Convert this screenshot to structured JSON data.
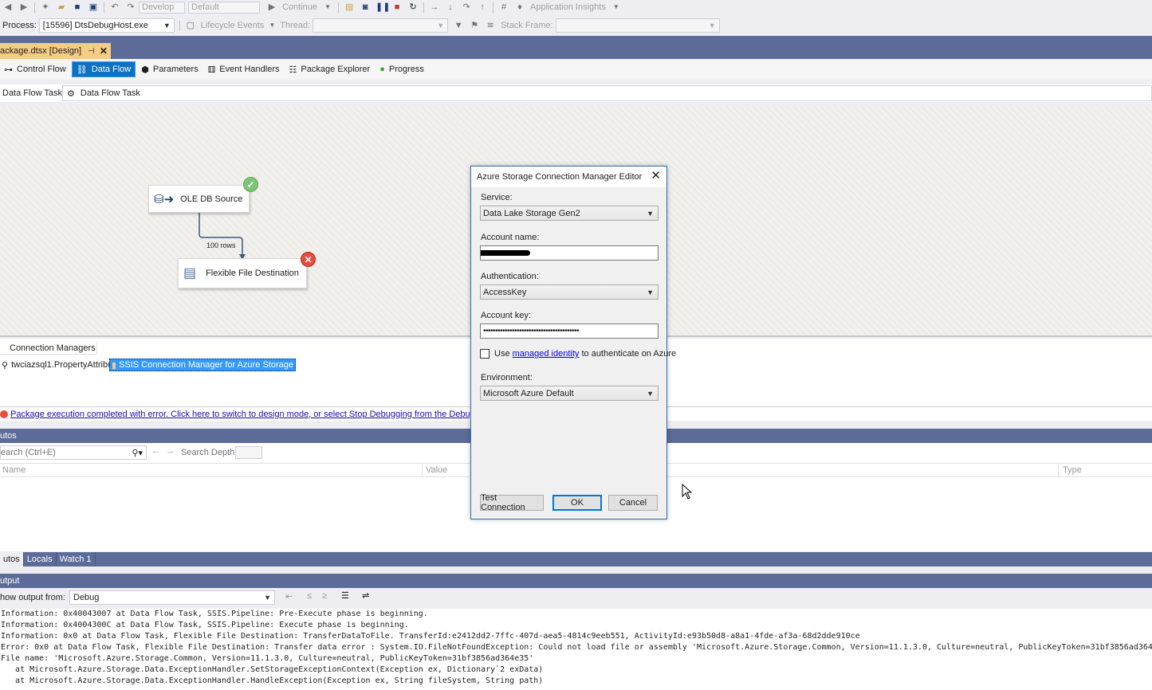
{
  "toolbar1": {
    "config_combo": "Develop",
    "platform_combo": "Default",
    "continue_label": "Continue",
    "app_insights": "Application Insights"
  },
  "toolbar2": {
    "process_label": "Process:",
    "process_value": "[15596] DtsDebugHost.exe",
    "lifecycle_label": "Lifecycle Events",
    "thread_label": "Thread:",
    "stack_frame_label": "Stack Frame:"
  },
  "doc_tab": {
    "title": "ackage.dtsx [Design]"
  },
  "designer_tabs": [
    {
      "label": "Control Flow",
      "icon": "control-flow-icon"
    },
    {
      "label": "Data Flow",
      "icon": "data-flow-icon",
      "active": true
    },
    {
      "label": "Parameters",
      "icon": "parameters-icon"
    },
    {
      "label": "Event Handlers",
      "icon": "event-handlers-icon"
    },
    {
      "label": "Package Explorer",
      "icon": "package-explorer-icon"
    },
    {
      "label": "Progress",
      "icon": "progress-icon"
    }
  ],
  "data_flow_task": {
    "label": "Data Flow Task:",
    "value": "Data Flow Task"
  },
  "canvas": {
    "source_node": "OLE DB Source",
    "rows_label": "100 rows",
    "dest_node": "Flexible File Destination"
  },
  "connection_managers": {
    "tab": "Connection Managers",
    "items": [
      "twciazsql1.PropertyAttribute",
      "SSIS Connection Manager for Azure Storage"
    ]
  },
  "status_link": "Package execution completed with error. Click here to switch to design mode, or select Stop Debugging from the Debug menu.",
  "autos": {
    "header": "utos",
    "search_placeholder": "earch (Ctrl+E)",
    "search_depth": "Search Depth:",
    "columns": [
      "Name",
      "Value",
      "Type"
    ]
  },
  "bottom_tabs": [
    "utos",
    "Locals",
    "Watch 1"
  ],
  "output": {
    "header": "utput",
    "show_from_label": "how output from:",
    "show_from_value": "Debug",
    "lines": [
      "Information: 0x40043007 at Data Flow Task, SSIS.Pipeline: Pre-Execute phase is beginning.",
      "Information: 0x4004300C at Data Flow Task, SSIS.Pipeline: Execute phase is beginning.",
      "Information: 0x0 at Data Flow Task, Flexible File Destination: TransferDataToFile. TransferId:e2412dd2-7ffc-407d-aea5-4814c9eeb551, ActivityId:e93b50d8-a8a1-4fde-af3a-68d2dde910ce",
      "Error: 0x0 at Data Flow Task, Flexible File Destination: Transfer data error : System.IO.FileNotFoundException: Could not load file or assembly 'Microsoft.Azure.Storage.Common, Version=11.1.3.0, Culture=neutral, PublicKeyToken=31bf3856ad364",
      "File name: 'Microsoft.Azure.Storage.Common, Version=11.1.3.0, Culture=neutral, PublicKeyToken=31bf3856ad364e35'",
      "   at Microsoft.Azure.Storage.Data.ExceptionHandler.SetStorageExceptionContext(Exception ex, Dictionary`2 exData)",
      "   at Microsoft.Azure.Storage.Data.ExceptionHandler.HandleException(Exception ex, String fileSystem, String path)"
    ]
  },
  "dialog": {
    "title": "Azure Storage Connection Manager Editor",
    "service_label": "Service:",
    "service_value": "Data Lake Storage Gen2",
    "account_name_label": "Account name:",
    "authentication_label": "Authentication:",
    "authentication_value": "AccessKey",
    "account_key_label": "Account key:",
    "account_key_value": "••••••••••••••••••••••••••••••••••••••••",
    "use_text": "Use",
    "managed_identity_link": "managed identity",
    "authenticate_text": "to authenticate on Azure",
    "environment_label": "Environment:",
    "environment_value": "Microsoft Azure Default",
    "test_button": "Test Connection",
    "ok_button": "OK",
    "cancel_button": "Cancel"
  },
  "colors": {
    "accent": "#0e70c0",
    "panel_header": "#5d6b99",
    "doc_tab": "#f5cc84",
    "error": "#e74c3c",
    "success": "#7cc576"
  }
}
